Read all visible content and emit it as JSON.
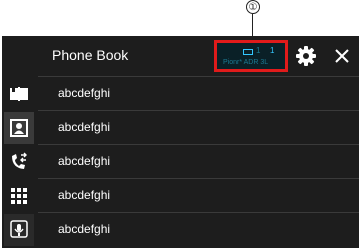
{
  "callout": "①",
  "header": {
    "title": "Phone Book",
    "status": {
      "bluetooth": "1",
      "signal": "1",
      "carrier": "Pionr* ADR 3L"
    }
  },
  "sidebar": {
    "items": [
      {
        "icon": "book-icon"
      },
      {
        "icon": "contact-card-icon",
        "active": true
      },
      {
        "icon": "call-history-icon"
      },
      {
        "icon": "keypad-icon"
      },
      {
        "icon": "voice-recognition-icon"
      }
    ]
  },
  "contacts": [
    {
      "name": "abcdefghi"
    },
    {
      "name": "abcdefghi"
    },
    {
      "name": "abcdefghi"
    },
    {
      "name": "abcdefghi"
    },
    {
      "name": "abcdefghi"
    }
  ],
  "colors": {
    "background": "#1d1d1d",
    "highlight": "#e01b1b",
    "accent": "#33c7ff"
  }
}
